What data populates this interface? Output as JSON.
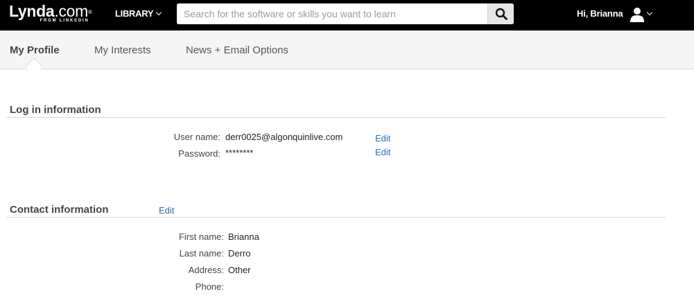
{
  "header": {
    "logo_main": "Lynda",
    "logo_dotcom": ".com",
    "logo_reg": "®",
    "logo_sub": "FROM LINKEDIN",
    "library_label": "LIBRARY",
    "search_placeholder": "Search for the software or skills you want to learn",
    "greeting": "Hi, Brianna"
  },
  "tabs": [
    {
      "label": "My Profile",
      "active": true
    },
    {
      "label": "My Interests",
      "active": false
    },
    {
      "label": "News + Email Options",
      "active": false
    }
  ],
  "login": {
    "title": "Log in information",
    "username_label": "User name:",
    "username_value": "derr0025@algonquinlive.com",
    "password_label": "Password:",
    "password_value": "********",
    "edit_label": "Edit"
  },
  "contact": {
    "title": "Contact information",
    "edit_label": "Edit",
    "first_name_label": "First name:",
    "first_name_value": "Brianna",
    "last_name_label": "Last name:",
    "last_name_value": "Derro",
    "address_label": "Address:",
    "address_value": "Other",
    "phone_label": "Phone:",
    "phone_value": ""
  },
  "colors": {
    "topbar": "#000000",
    "link": "#2a6fb8",
    "subnav": "#f5f5f5"
  },
  "icons": {
    "search": "search-icon",
    "user": "user-icon"
  }
}
